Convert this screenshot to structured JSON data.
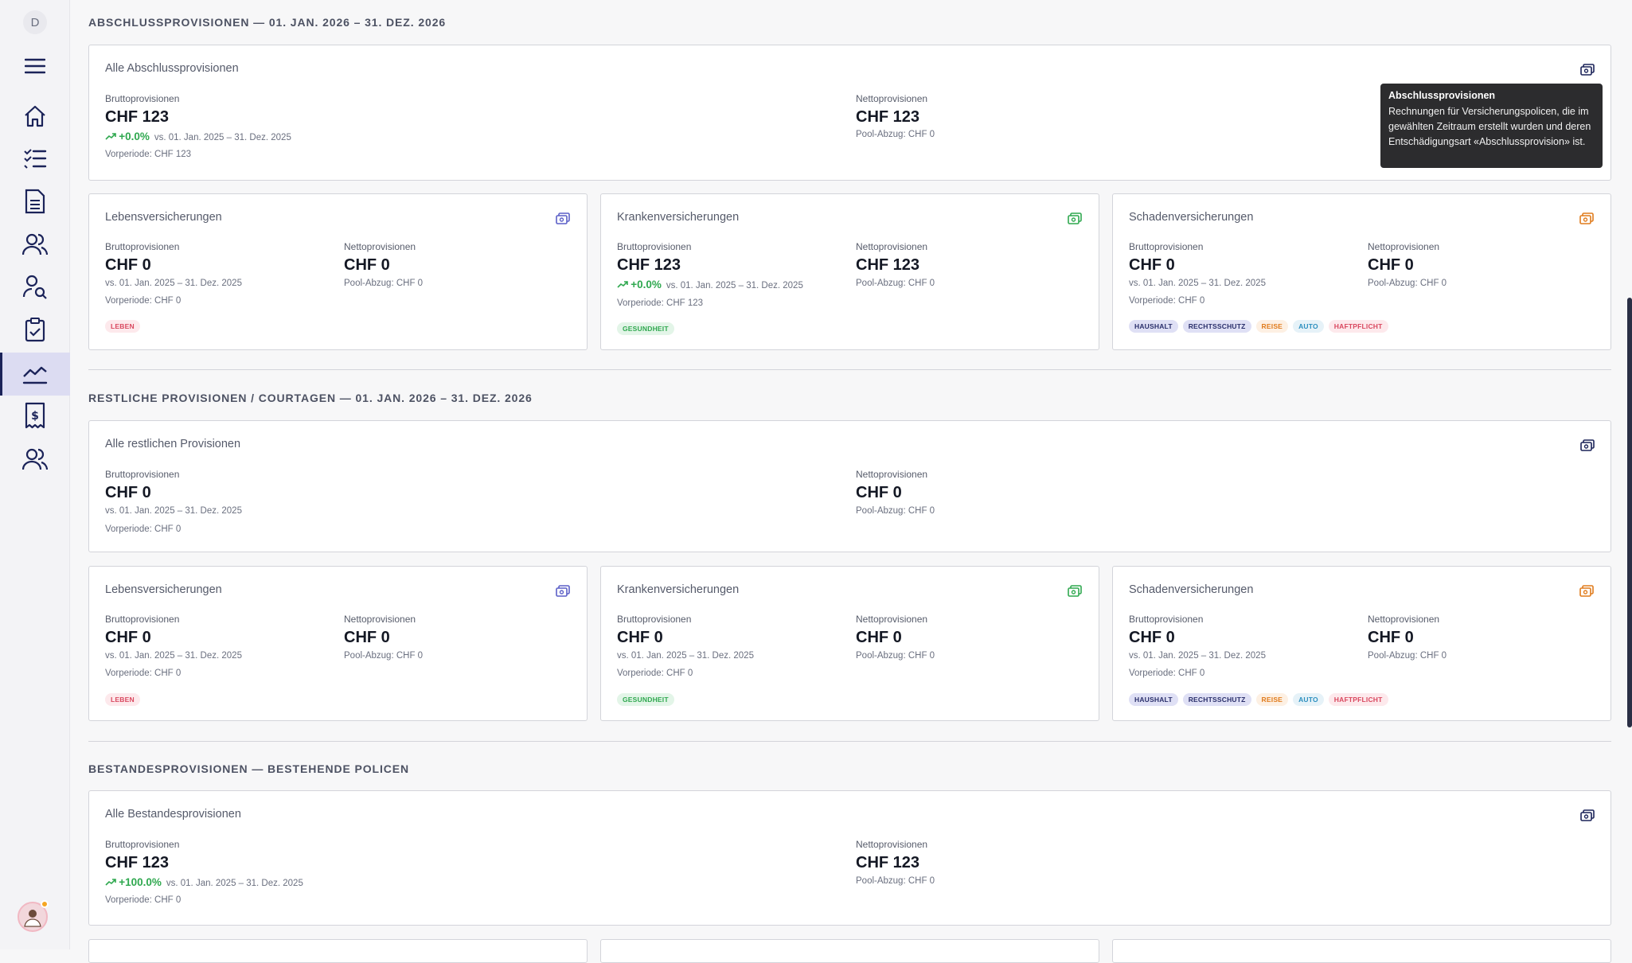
{
  "sidebar": {
    "initial": "D"
  },
  "sections": [
    {
      "title": "ABSCHLUSSPROVISIONEN — 01. JAN. 2026 – 31. DEZ. 2026"
    },
    {
      "title": "RESTLICHE PROVISIONEN / COURTAGEN — 01. JAN. 2026 – 31. DEZ. 2026"
    },
    {
      "title": "BESTANDESPROVISIONEN — BESTEHENDE POLICEN"
    }
  ],
  "labels": {
    "brutto": "Bruttoprovisionen",
    "netto": "Nettoprovisionen"
  },
  "tooltip": {
    "title": "Abschlussprovisionen",
    "body": "Rechnungen für Versicherungspolicen, die im gewählten Zeitraum erstellt wurden und deren Entschädigungsart «Abschlussprovision» ist."
  },
  "s1": {
    "all": {
      "title": "Alle Abschlussprovisionen",
      "brutto": "CHF 123",
      "trend": "+0.0%",
      "compare": "vs. 01. Jan. 2025 – 31. Dez. 2025",
      "prev": "Vorperiode: CHF 123",
      "netto": "CHF 123",
      "pool": "Pool-Abzug: CHF 0"
    },
    "leben": {
      "title": "Lebensversicherungen",
      "brutto": "CHF 0",
      "compare": "vs. 01. Jan. 2025 – 31. Dez. 2025",
      "prev": "Vorperiode: CHF 0",
      "netto": "CHF 0",
      "pool": "Pool-Abzug: CHF 0",
      "tag": "LEBEN"
    },
    "kranken": {
      "title": "Krankenversicherungen",
      "brutto": "CHF 123",
      "trend": "+0.0%",
      "compare": "vs. 01. Jan. 2025 – 31. Dez. 2025",
      "prev": "Vorperiode: CHF 123",
      "netto": "CHF 123",
      "pool": "Pool-Abzug: CHF 0",
      "tag": "GESUNDHEIT"
    },
    "schaden": {
      "title": "Schadenversicherungen",
      "brutto": "CHF 0",
      "compare": "vs. 01. Jan. 2025 – 31. Dez. 2025",
      "prev": "Vorperiode: CHF 0",
      "netto": "CHF 0",
      "pool": "Pool-Abzug: CHF 0",
      "tags": [
        "HAUSHALT",
        "RECHTSSCHUTZ",
        "REISE",
        "AUTO",
        "HAFTPFLICHT"
      ]
    }
  },
  "s2": {
    "all": {
      "title": "Alle restlichen Provisionen",
      "brutto": "CHF 0",
      "compare": "vs. 01. Jan. 2025 – 31. Dez. 2025",
      "prev": "Vorperiode: CHF 0",
      "netto": "CHF 0",
      "pool": "Pool-Abzug: CHF 0"
    },
    "leben": {
      "title": "Lebensversicherungen",
      "brutto": "CHF 0",
      "compare": "vs. 01. Jan. 2025 – 31. Dez. 2025",
      "prev": "Vorperiode: CHF 0",
      "netto": "CHF 0",
      "pool": "Pool-Abzug: CHF 0",
      "tag": "LEBEN"
    },
    "kranken": {
      "title": "Krankenversicherungen",
      "brutto": "CHF 0",
      "compare": "vs. 01. Jan. 2025 – 31. Dez. 2025",
      "prev": "Vorperiode: CHF 0",
      "netto": "CHF 0",
      "pool": "Pool-Abzug: CHF 0",
      "tag": "GESUNDHEIT"
    },
    "schaden": {
      "title": "Schadenversicherungen",
      "brutto": "CHF 0",
      "compare": "vs. 01. Jan. 2025 – 31. Dez. 2025",
      "prev": "Vorperiode: CHF 0",
      "netto": "CHF 0",
      "pool": "Pool-Abzug: CHF 0",
      "tags": [
        "HAUSHALT",
        "RECHTSSCHUTZ",
        "REISE",
        "AUTO",
        "HAFTPFLICHT"
      ]
    }
  },
  "s3": {
    "all": {
      "title": "Alle Bestandesprovisionen",
      "brutto": "CHF 123",
      "trend": "+100.0%",
      "compare": "vs. 01. Jan. 2025 – 31. Dez. 2025",
      "prev": "Vorperiode: CHF 0",
      "netto": "CHF 123",
      "pool": "Pool-Abzug: CHF 0"
    }
  },
  "colors": {
    "navy": "#1b2359",
    "leben": "#5b5fc7",
    "kranken": "#2fa84f",
    "schaden": "#e07b1c"
  }
}
